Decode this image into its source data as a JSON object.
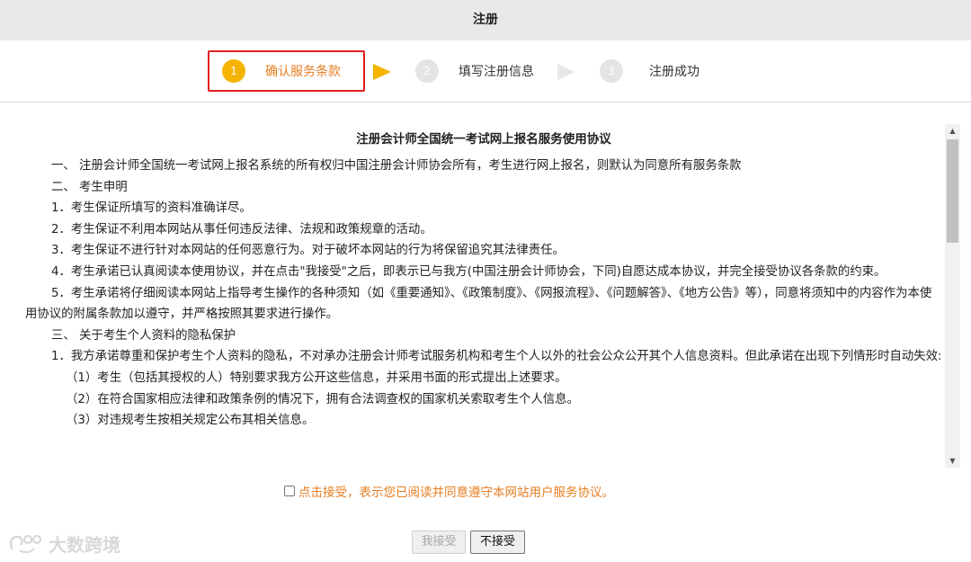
{
  "header": {
    "title": "注册"
  },
  "steps": [
    {
      "number": "1",
      "label": "确认服务条款",
      "state": "active"
    },
    {
      "number": "2",
      "label": "填写注册信息",
      "state": "pending"
    },
    {
      "number": "3",
      "label": "注册成功",
      "state": "pending"
    }
  ],
  "agreement": {
    "title": "注册会计师全国统一考试网上报名服务使用协议",
    "paragraphs": [
      "一、 注册会计师全国统一考试网上报名系统的所有权归中国注册会计师协会所有，考生进行网上报名，则默认为同意所有服务条款",
      "二、 考生申明",
      "1．考生保证所填写的资料准确详尽。",
      "2．考生保证不利用本网站从事任何违反法律、法规和政策规章的活动。",
      "3．考生保证不进行针对本网站的任何恶意行为。对于破坏本网站的行为将保留追究其法律责任。",
      "4．考生承诺已认真阅读本使用协议，并在点击\"我接受\"之后，即表示已与我方(中国注册会计师协会，下同)自愿达成本协议，并完全接受协议各条款的约束。",
      "5．考生承诺将仔细阅读本网站上指导考生操作的各种须知（如《重要通知》、《政策制度》、《网报流程》、《问题解答》、《地方公告》等），同意将须知中的内容作为本使用协议的附属条款加以遵守，并严格按照其要求进行操作。",
      "三、 关于考生个人资料的隐私保护",
      "1．我方承诺尊重和保护考生个人资料的隐私，不对承办注册会计师考试服务机构和考生个人以外的社会公众公开其个人信息资料。但此承诺在出现下列情形时自动失效:"
    ],
    "subitems": [
      "（1）考生（包括其授权的人）特别要求我方公开这些信息，并采用书面的形式提出上述要求。",
      "（2）在符合国家相应法律和政策条例的情况下，拥有合法调查权的国家机关索取考生个人信息。",
      "（3）对违规考生按相关规定公布其相关信息。"
    ]
  },
  "scrollbar": {
    "up_glyph": "▲",
    "down_glyph": "▼"
  },
  "accept": {
    "text": "点击接受，表示您已阅读并同意遵守本网站用户服务协议。",
    "checked": false
  },
  "buttons": {
    "accept": "我接受",
    "reject": "不接受"
  },
  "watermark": {
    "text": "大数跨境"
  },
  "colors": {
    "accent": "#e67e22",
    "step_active": "#f5b400",
    "highlight": "#e02020"
  },
  "icons": {
    "step_arrow": "chevron-right-icon",
    "logo": "watermark-logo-icon"
  }
}
